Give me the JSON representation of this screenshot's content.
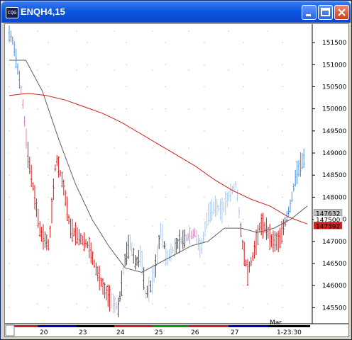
{
  "window": {
    "title": "ENQH4,15",
    "icon_text": "CQG"
  },
  "colors": {
    "up_bar": "#4a90e2",
    "down_bar": "#d41c1c",
    "light_up_bar": "#a8c8ec",
    "pink_bar": "#e080c0",
    "dark_bar": "#404040",
    "ma_short": "#606060",
    "ma_long": "#d41c1c",
    "grid": "#b0b0b0"
  },
  "chart_data": {
    "type": "bar",
    "subtype": "ohlc",
    "title": "ENQH4,15",
    "yaxis": {
      "ticks": [
        151500,
        151000,
        150500,
        150000,
        149500,
        149000,
        148500,
        148000,
        147500,
        147000,
        146500,
        146000,
        145500
      ],
      "ylim": [
        145137,
        151854
      ]
    },
    "xaxis": {
      "labels": [
        "20",
        "23",
        "24",
        "25",
        "26",
        "27",
        "Mar",
        "1-23:30"
      ],
      "session_colors": [
        "#d41c1c",
        "#0000c0",
        "#000000",
        "#d41c1c",
        "#00a000",
        "#d41c1c",
        "#0000c0",
        "#000000"
      ]
    },
    "price_labels": [
      {
        "text": "147632",
        "bg": "#c0c0c0",
        "fg": "#000000"
      },
      {
        "text": "147500",
        "bg": "#ffffff",
        "fg": "#000000"
      },
      {
        "text": "147392",
        "bg": "#d41c1c",
        "fg": "#ffffff"
      }
    ],
    "ma_long_values": [
      150300,
      150350,
      150300,
      150200,
      150050,
      149900,
      149700,
      149450,
      149200,
      148950,
      148700,
      148400,
      148150,
      147950,
      147800,
      147550,
      147392
    ],
    "ma_short_values": [
      151100,
      151100,
      150400,
      149300,
      148300,
      147500,
      146900,
      146400,
      146300,
      146500,
      146700,
      146900,
      147000,
      147300,
      147300,
      147200,
      147300,
      147500,
      147800
    ]
  }
}
